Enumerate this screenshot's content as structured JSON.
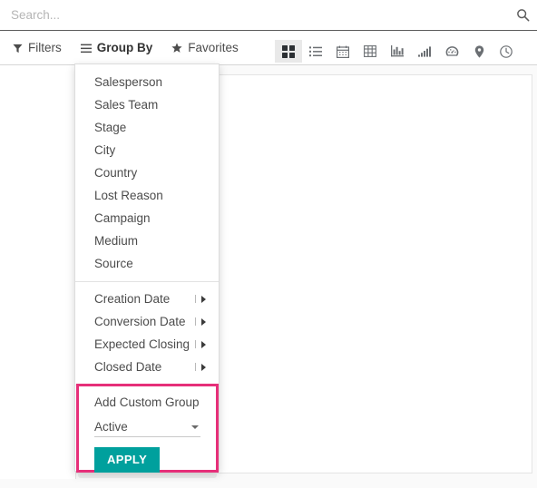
{
  "search": {
    "placeholder": "Search...",
    "value": "",
    "icon": "search-icon"
  },
  "toolbar": {
    "filters_label": "Filters",
    "filters_icon": "filter-icon",
    "group_by_label": "Group By",
    "group_by_icon": "list-lines-icon",
    "favorites_label": "Favorites",
    "favorites_icon": "star-icon"
  },
  "view_switcher": {
    "active_index": 0,
    "views": [
      {
        "name": "kanban-view-icon",
        "title": "Kanban"
      },
      {
        "name": "list-view-icon",
        "title": "List"
      },
      {
        "name": "calendar-view-icon",
        "title": "Calendar"
      },
      {
        "name": "pivot-view-icon",
        "title": "Pivot"
      },
      {
        "name": "graph-view-icon",
        "title": "Graph"
      },
      {
        "name": "cohort-view-icon",
        "title": "Cohort"
      },
      {
        "name": "dashboard-view-icon",
        "title": "Dashboard"
      },
      {
        "name": "map-view-icon",
        "title": "Map"
      },
      {
        "name": "activity-view-icon",
        "title": "Activity"
      }
    ]
  },
  "group_by_menu": {
    "fields": [
      {
        "label": "Salesperson"
      },
      {
        "label": "Sales Team"
      },
      {
        "label": "Stage"
      },
      {
        "label": "City"
      },
      {
        "label": "Country"
      },
      {
        "label": "Lost Reason"
      },
      {
        "label": "Campaign"
      },
      {
        "label": "Medium"
      },
      {
        "label": "Source"
      }
    ],
    "date_fields": [
      {
        "label": "Creation Date"
      },
      {
        "label": "Conversion Date"
      },
      {
        "label": "Expected Closing"
      },
      {
        "label": "Closed Date"
      }
    ],
    "custom_group": {
      "title": "Add Custom Group",
      "selected_field": "Active",
      "apply_label": "APPLY",
      "highlight_color": "#e62f79",
      "apply_color": "#00a09d"
    }
  }
}
